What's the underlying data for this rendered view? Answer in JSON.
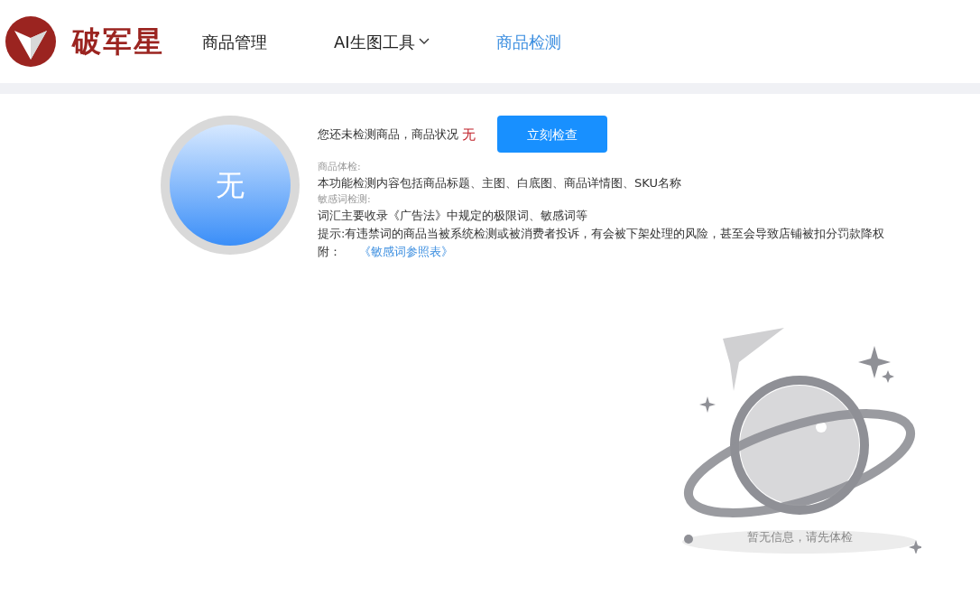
{
  "brand": {
    "name": "破军星"
  },
  "nav": [
    {
      "label": "商品管理",
      "selected": false,
      "dropdown": false
    },
    {
      "label": "AI生图工具",
      "selected": false,
      "dropdown": true
    },
    {
      "label": "商品检测",
      "selected": true,
      "dropdown": false
    }
  ],
  "status": {
    "circle_label": "无",
    "prompt": "您还未检测商品，商品状况",
    "value": "无",
    "button": "立刻检查"
  },
  "sections": [
    {
      "kind": "heading",
      "text": "商品体检:"
    },
    {
      "kind": "body",
      "text": "本功能检测内容包括商品标题、主图、白底图、商品详情图、SKU名称"
    },
    {
      "kind": "heading",
      "text": "敏感词检测:"
    },
    {
      "kind": "body",
      "text": "词汇主要收录《广告法》中规定的极限词、敏感词等"
    },
    {
      "kind": "body",
      "text": "提示:有违禁词的商品当被系统检测或被消费者投诉，有会被下架处理的风险，甚至会导致店铺被扣分罚款降权"
    },
    {
      "kind": "link",
      "text": "附：",
      "link": "《敏感词参照表》"
    }
  ],
  "empty_state": {
    "text": "暂无信息，请先体检"
  }
}
